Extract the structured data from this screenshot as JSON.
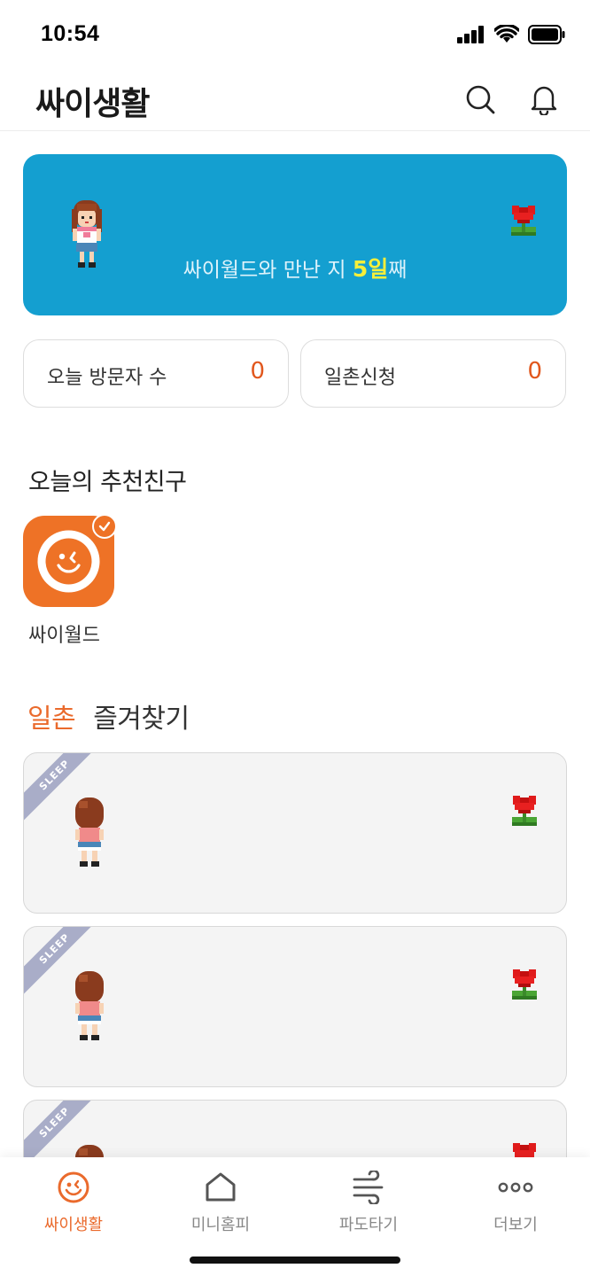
{
  "status_bar": {
    "time": "10:54"
  },
  "header": {
    "title": "싸이생활"
  },
  "banner": {
    "text_prefix": "싸이월드와 만난 지 ",
    "days": "5일",
    "text_suffix": "째"
  },
  "stats": [
    {
      "label": "오늘 방문자 수",
      "value": "0"
    },
    {
      "label": "일촌신청",
      "value": "0"
    }
  ],
  "recommended": {
    "title": "오늘의 추천친구",
    "friends": [
      {
        "name": "싸이월드"
      }
    ]
  },
  "tabs": [
    {
      "label": "일촌",
      "active": true
    },
    {
      "label": "즐겨찾기",
      "active": false
    }
  ],
  "friend_cards": [
    {
      "ribbon": "SLEEP"
    },
    {
      "ribbon": "SLEEP"
    },
    {
      "ribbon": "SLEEP"
    }
  ],
  "bottom_nav": [
    {
      "label": "싸이생활",
      "icon": "smiley-icon",
      "active": true
    },
    {
      "label": "미니홈피",
      "icon": "home-icon",
      "active": false
    },
    {
      "label": "파도타기",
      "icon": "wave-icon",
      "active": false
    },
    {
      "label": "더보기",
      "icon": "more-icon",
      "active": false
    }
  ],
  "colors": {
    "accent": "#ea6a2c",
    "banner": "#149fd0",
    "value": "#e1571d",
    "highlight": "#f6ef3a"
  }
}
